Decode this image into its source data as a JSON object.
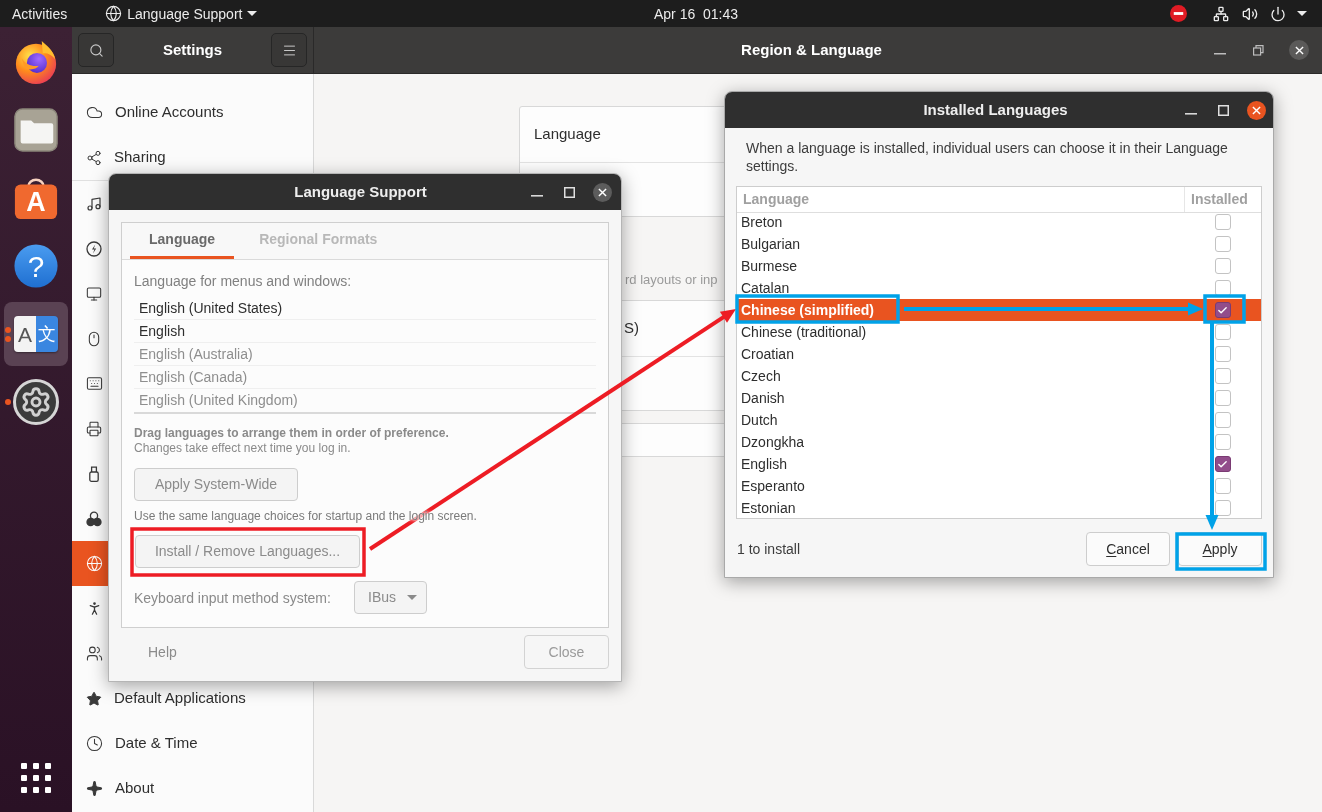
{
  "top_bar": {
    "activities": "Activities",
    "app_menu": "Language Support",
    "clock": "Apr 16  01:43"
  },
  "dock": {
    "items": [
      {
        "running": false,
        "focused": false
      },
      {
        "running": false,
        "focused": false
      },
      {
        "running": false,
        "focused": false,
        "glyphs": [
          "A"
        ]
      },
      {
        "running": false,
        "focused": false,
        "glyphs": [
          "?"
        ]
      },
      {
        "running": true,
        "multiple_windows": true,
        "focused": true,
        "glyphs": [
          "A",
          "文"
        ]
      },
      {
        "running": true,
        "multiple_windows": false,
        "focused": false
      }
    ]
  },
  "settings": {
    "title": "Settings",
    "page_title": "Region & Language",
    "sidebar": {
      "groups": [
        {
          "items": [
            {
              "label": "Online Accounts",
              "selected": false
            },
            {
              "label": "Sharing",
              "selected": false
            }
          ]
        },
        {
          "items": [
            {
              "selected": false
            },
            {
              "selected": false
            },
            {
              "selected": false
            },
            {
              "selected": false
            },
            {
              "selected": false
            },
            {
              "selected": false
            },
            {
              "selected": false
            },
            {
              "selected": false
            },
            {
              "selected": true
            },
            {
              "selected": false
            },
            {
              "selected": false
            },
            {
              "label": "Default Applications",
              "selected": false
            },
            {
              "label": "Date & Time",
              "selected": false
            },
            {
              "label": "About",
              "selected": false
            }
          ]
        }
      ]
    },
    "content": {
      "language_row": "Language",
      "input_hint": "rd layouts or inp",
      "input_source": "S)"
    }
  },
  "language_support": {
    "title": "Language Support",
    "tabs": [
      {
        "label": "Language",
        "selected": true
      },
      {
        "label": "Regional Formats",
        "selected": false
      }
    ],
    "list_label": "Language for menus and windows:",
    "languages": [
      {
        "name": "English (United States)",
        "active": true
      },
      {
        "name": "English",
        "active": true
      },
      {
        "name": "English (Australia)",
        "active": false
      },
      {
        "name": "English (Canada)",
        "active": false
      },
      {
        "name": "English (United Kingdom)",
        "active": false
      }
    ],
    "drag_hint": "Drag languages to arrange them in order of preference.",
    "drag_note": "Changes take effect next time you log in.",
    "apply_system_wide": "Apply System-Wide",
    "system_wide_note": "Use the same language choices for startup and the login screen.",
    "install_remove": "Install / Remove Languages...",
    "input_method_label": "Keyboard input method system:",
    "input_method": "IBus",
    "help": "Help",
    "close": "Close"
  },
  "installed_languages": {
    "title": "Installed Languages",
    "description": "When a language is installed, individual users can choose it in their Language settings.",
    "columns": [
      "Language",
      "Installed"
    ],
    "rows": [
      {
        "name": "Breton",
        "installed": false,
        "selected": false
      },
      {
        "name": "Bulgarian",
        "installed": false,
        "selected": false
      },
      {
        "name": "Burmese",
        "installed": false,
        "selected": false
      },
      {
        "name": "Catalan",
        "installed": false,
        "selected": false
      },
      {
        "name": "Chinese (simplified)",
        "installed": true,
        "selected": true
      },
      {
        "name": "Chinese (traditional)",
        "installed": false,
        "selected": false
      },
      {
        "name": "Croatian",
        "installed": false,
        "selected": false
      },
      {
        "name": "Czech",
        "installed": false,
        "selected": false
      },
      {
        "name": "Danish",
        "installed": false,
        "selected": false
      },
      {
        "name": "Dutch",
        "installed": false,
        "selected": false
      },
      {
        "name": "Dzongkha",
        "installed": false,
        "selected": false
      },
      {
        "name": "English",
        "installed": true,
        "selected": false
      },
      {
        "name": "Esperanto",
        "installed": false,
        "selected": false
      },
      {
        "name": "Estonian",
        "installed": false,
        "selected": false
      }
    ],
    "status": "1 to install",
    "buttons": [
      {
        "label": "Cancel",
        "mnemonic": true
      },
      {
        "label": "Apply",
        "mnemonic": true
      }
    ]
  },
  "annotations": [
    {
      "kind": "frame",
      "color": "#ed1c24"
    },
    {
      "kind": "arrow",
      "color": "#ed1c24"
    },
    {
      "kind": "frame",
      "color": "#00a2e8"
    },
    {
      "kind": "arrow",
      "color": "#00a2e8"
    },
    {
      "kind": "frame",
      "color": "#00a2e8"
    },
    {
      "kind": "arrow",
      "color": "#00a2e8"
    },
    {
      "kind": "frame",
      "color": "#00a2e8"
    }
  ]
}
